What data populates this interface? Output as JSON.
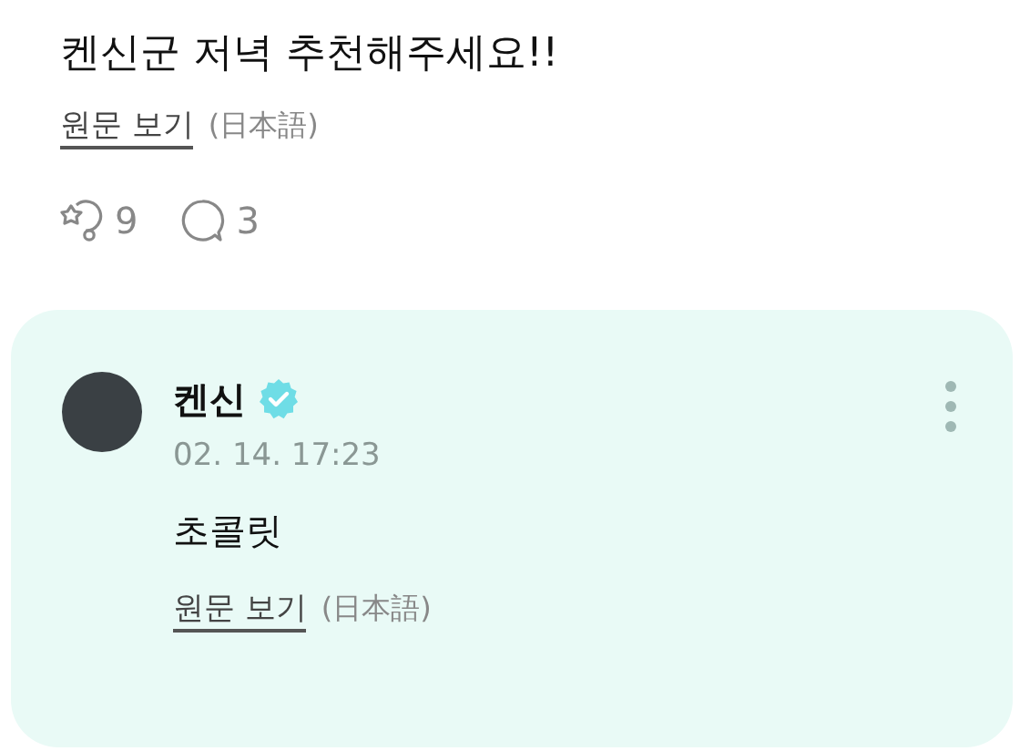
{
  "post": {
    "text": "켄신군 저녁 추천해주세요!!",
    "original_link": "원문 보기",
    "language": "(日本語)",
    "reactions": "9",
    "comments": "3"
  },
  "reply": {
    "author": "켄신",
    "verified": true,
    "time": "02. 14. 17:23",
    "text": "초콜릿",
    "original_link": "원문 보기",
    "language": "(日本語)"
  }
}
